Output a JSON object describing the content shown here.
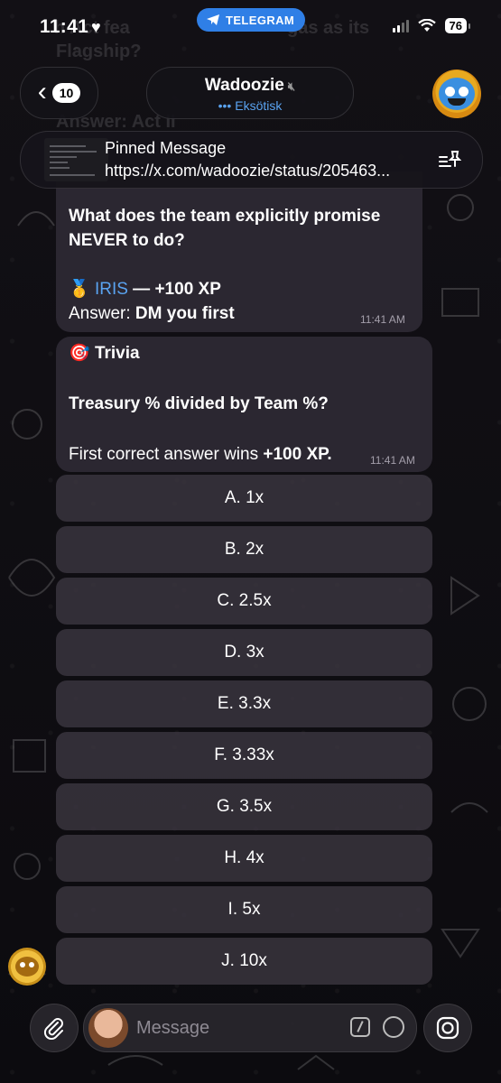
{
  "status_bar": {
    "time": "11:41",
    "telegram_pill": "TELEGRAM",
    "battery": "76"
  },
  "ghost_text": {
    "line1": "h Act fea",
    "line1b": "gas as its",
    "line2": "Flagship?",
    "line3": "Answer: Act II"
  },
  "header": {
    "back_count": "10",
    "title": "Wadoozie",
    "subtitle": "Eksötisk"
  },
  "pinned": {
    "title": "Pinned Message",
    "link": "https://x.com/wadoozie/status/205463..."
  },
  "messages": [
    {
      "line1": "What does the team explicitly promise",
      "line2": "NEVER to do?",
      "medal": "🥇",
      "winner": "IRIS",
      "reward": " — +100 XP",
      "answer_label": "Answer: ",
      "answer": "DM you first",
      "time": "11:41 AM"
    },
    {
      "header_icon": "🎯",
      "header": "Trivia",
      "question": "Treasury % divided by Team %?",
      "footer_text": "First correct answer wins ",
      "footer_bold": "+100 XP.",
      "time": "11:41 AM"
    }
  ],
  "options": [
    "A. 1x",
    "B. 2x",
    "C. 2.5x",
    "D. 3x",
    "E. 3.3x",
    "F. 3.33x",
    "G. 3.5x",
    "H. 4x",
    "I. 5x",
    "J. 10x"
  ],
  "composer": {
    "placeholder": "Message"
  }
}
